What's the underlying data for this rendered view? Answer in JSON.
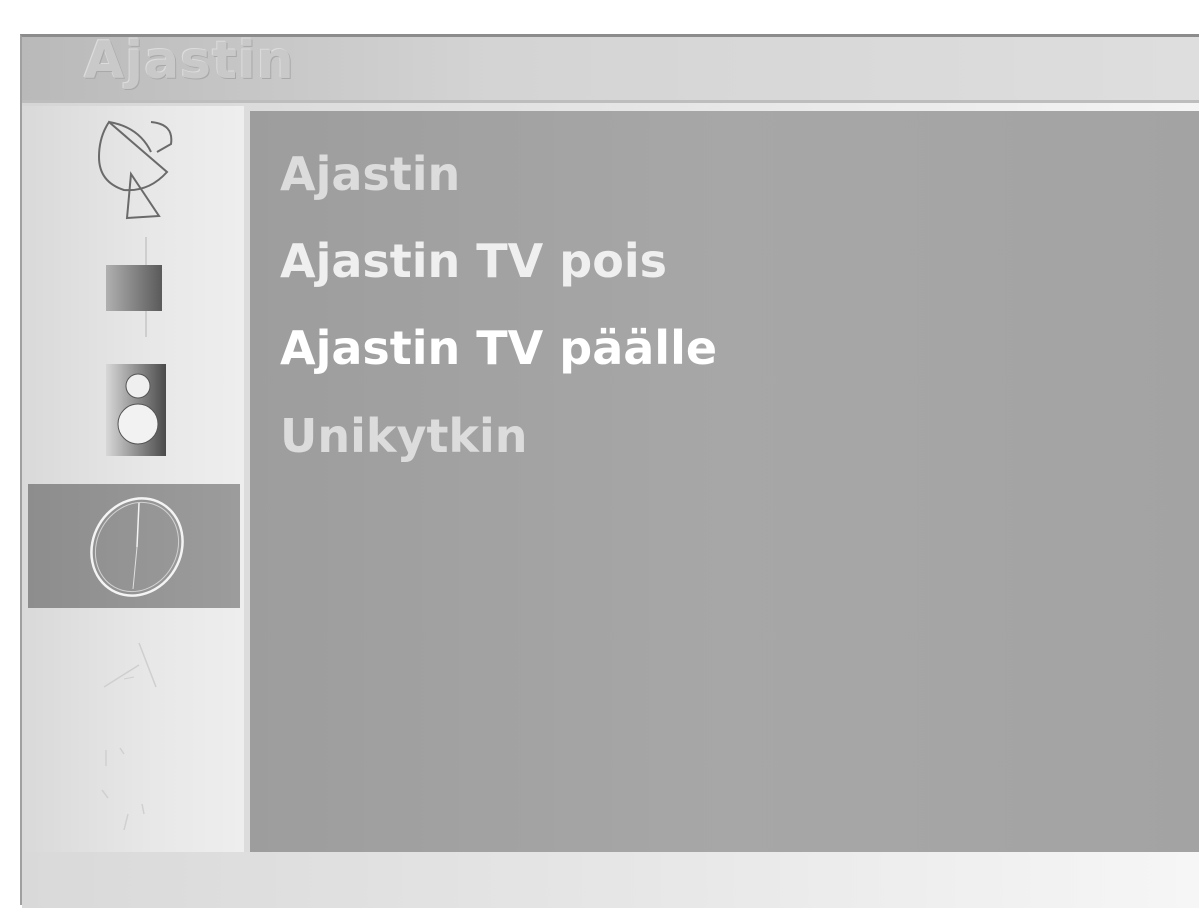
{
  "header": {
    "title": "Ajastin"
  },
  "sidebar": {
    "items": [
      {
        "icon": "satellite-dish-icon",
        "selected": false
      },
      {
        "icon": "picture-icon",
        "selected": false
      },
      {
        "icon": "audio-speaker-icon",
        "selected": false
      },
      {
        "icon": "timer-clock-icon",
        "selected": true
      },
      {
        "icon": "special-icon",
        "selected": false
      },
      {
        "icon": "setup-icon",
        "selected": false
      }
    ]
  },
  "menu": {
    "items": [
      {
        "label": "Ajastin"
      },
      {
        "label": "Ajastin TV pois"
      },
      {
        "label": "Ajastin TV päälle"
      },
      {
        "label": "Unikytkin"
      }
    ]
  },
  "colors": {
    "content_bg": "#a3a3a3",
    "selected_bg": "#959595",
    "menu_text": "#ffffff"
  }
}
